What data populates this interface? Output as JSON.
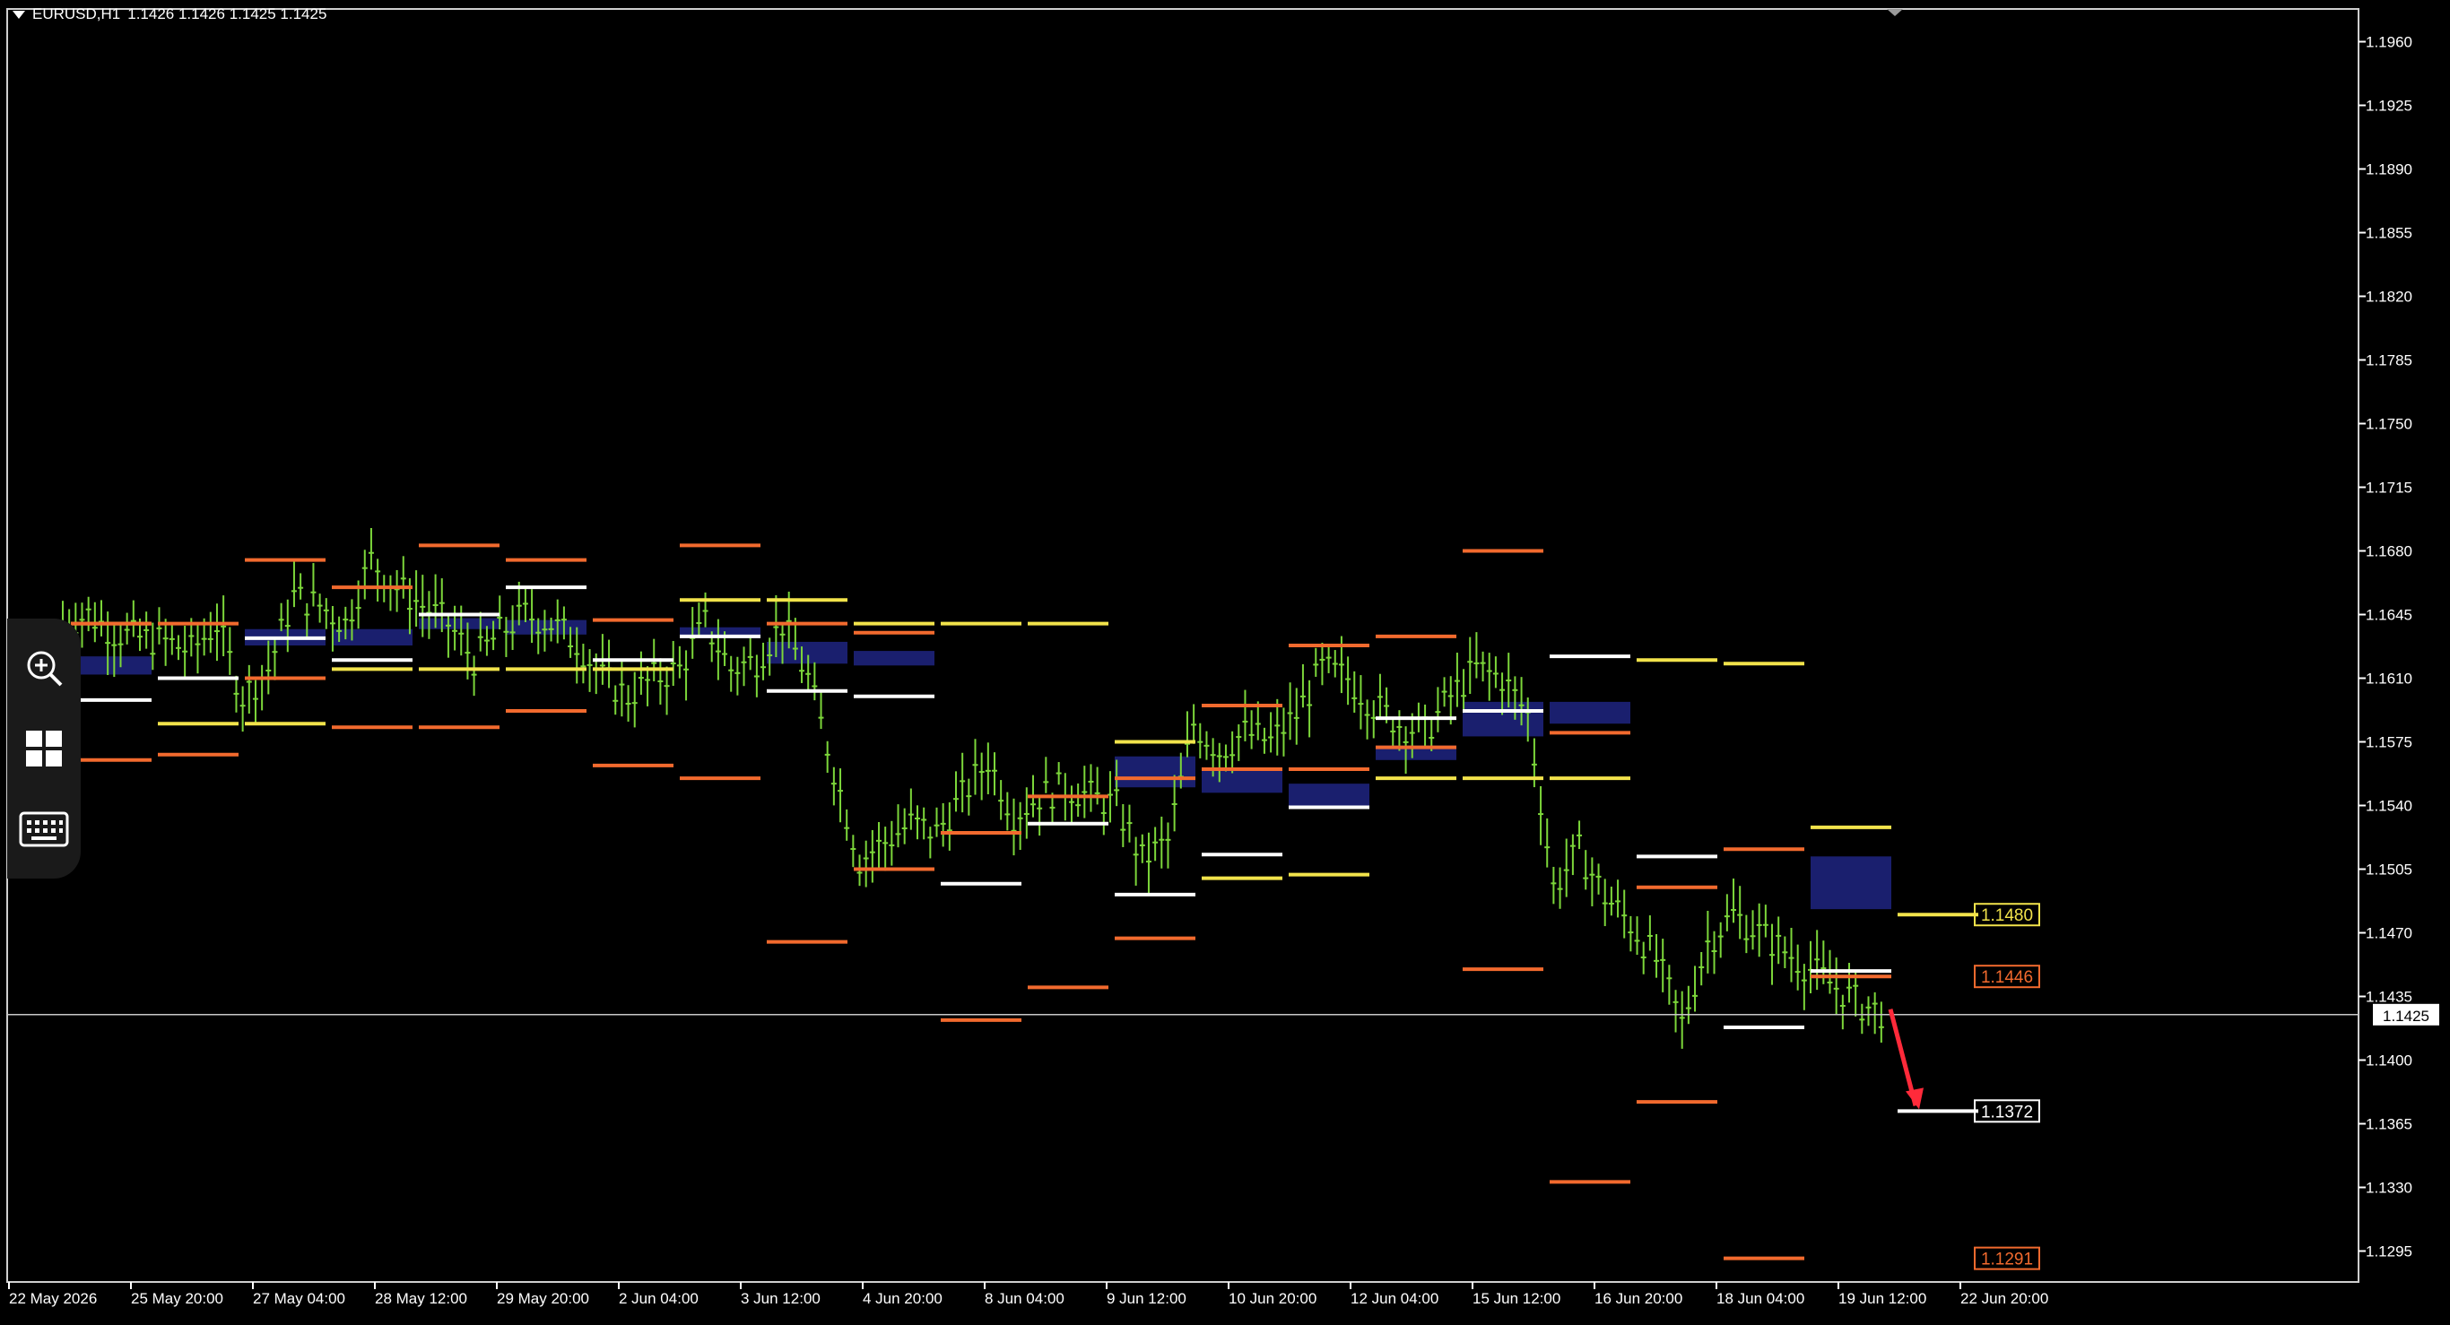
{
  "window": {
    "symbol_label": "EURUSD,H1",
    "ohlc_label": "1.1426 1.1426 1.1425 1.1425",
    "menu_icon": "triangle-down-icon"
  },
  "colors": {
    "background": "#000000",
    "candles": "#7cd63a",
    "axis": "#ffffff",
    "yellow_level": "#f2e34b",
    "orange_level": "#f26a2e",
    "white_level": "#ffffff",
    "zone_fill": "#1a1f6e",
    "arrow": "#ff2a3a",
    "bid_line": "#c8c8c8"
  },
  "price_axis": {
    "min": 1.1278,
    "max": 1.1978,
    "ticks": [
      "1.1960",
      "1.1925",
      "1.1890",
      "1.1855",
      "1.1820",
      "1.1785",
      "1.1750",
      "1.1715",
      "1.1680",
      "1.1645",
      "1.1610",
      "1.1575",
      "1.1540",
      "1.1505",
      "1.1470",
      "1.1435",
      "1.1400",
      "1.1365",
      "1.1330",
      "1.1295"
    ],
    "current_price_label": "1.1425",
    "current_price": 1.1425
  },
  "time_axis": {
    "labels": [
      "22 May 2026",
      "25 May 20:00",
      "27 May 04:00",
      "28 May 12:00",
      "29 May 20:00",
      "2 Jun 04:00",
      "3 Jun 12:00",
      "4 Jun 20:00",
      "8 Jun 04:00",
      "9 Jun 12:00",
      "10 Jun 20:00",
      "12 Jun 04:00",
      "15 Jun 12:00",
      "16 Jun 20:00",
      "18 Jun 04:00",
      "19 Jun 12:00",
      "22 Jun 20:00"
    ]
  },
  "price_labels": [
    {
      "text": "1.1480",
      "price": 1.148,
      "color": "#f2e34b"
    },
    {
      "text": "1.1446",
      "price": 1.1446,
      "color": "#f26a2e"
    },
    {
      "text": "1.1372",
      "price": 1.1372,
      "color": "#ffffff"
    },
    {
      "text": "1.1291",
      "price": 1.1291,
      "color": "#f26a2e"
    }
  ],
  "chart_data": {
    "type": "line",
    "description_units": "EURUSD H1 approximate close path",
    "x_labels": [
      "22 May 2026",
      "25 May 20:00",
      "27 May 04:00",
      "28 May 12:00",
      "29 May 20:00",
      "2 Jun 04:00",
      "3 Jun 12:00",
      "4 Jun 20:00",
      "8 Jun 04:00",
      "9 Jun 12:00",
      "10 Jun 20:00",
      "12 Jun 04:00",
      "15 Jun 12:00",
      "16 Jun 20:00",
      "18 Jun 04:00",
      "19 Jun 12:00",
      "22 Jun 20:00"
    ],
    "price_path": [
      1.164,
      1.1645,
      1.1635,
      1.1632,
      1.163,
      1.1625,
      1.164,
      1.16,
      1.1615,
      1.1655,
      1.165,
      1.164,
      1.1675,
      1.166,
      1.165,
      1.164,
      1.162,
      1.1635,
      1.1645,
      1.164,
      1.163,
      1.161,
      1.16,
      1.161,
      1.1615,
      1.164,
      1.1615,
      1.162,
      1.164,
      1.161,
      1.156,
      1.151,
      1.152,
      1.153,
      1.1525,
      1.1545,
      1.1565,
      1.1535,
      1.1545,
      1.155,
      1.1545,
      1.154,
      1.151,
      1.152,
      1.1585,
      1.157,
      1.158,
      1.1575,
      1.159,
      1.1615,
      1.161,
      1.1595,
      1.1585,
      1.158,
      1.16,
      1.1615,
      1.161,
      1.159,
      1.1495,
      1.1515,
      1.149,
      1.1475,
      1.1455,
      1.142,
      1.1465,
      1.148,
      1.147,
      1.146,
      1.145,
      1.144,
      1.143,
      1.1425
    ],
    "level_segments": {
      "yellow": [
        [
          1,
          1.164
        ],
        [
          2,
          1.1585
        ],
        [
          3,
          1.1585
        ],
        [
          4,
          1.1615
        ],
        [
          5,
          1.1615
        ],
        [
          6,
          1.1615
        ],
        [
          7,
          1.1615
        ],
        [
          8,
          1.1653
        ],
        [
          9,
          1.1653
        ],
        [
          10,
          1.164
        ],
        [
          11,
          1.164
        ],
        [
          12,
          1.164
        ],
        [
          13,
          1.1575
        ],
        [
          14,
          1.15
        ],
        [
          15,
          1.1502
        ],
        [
          16,
          1.1555
        ],
        [
          17,
          1.1555
        ],
        [
          18,
          1.1555
        ],
        [
          19,
          1.162
        ],
        [
          20,
          1.1618
        ],
        [
          21,
          1.1528
        ],
        [
          22,
          1.148
        ]
      ],
      "orange_top": [
        [
          1,
          1.164
        ],
        [
          2,
          1.164
        ],
        [
          3,
          1.1675
        ],
        [
          4,
          1.166
        ],
        [
          5,
          1.1683
        ],
        [
          6,
          1.1675
        ],
        [
          7,
          1.1642
        ],
        [
          8,
          1.1683
        ],
        [
          9,
          1.164
        ],
        [
          10,
          1.1635
        ],
        [
          11,
          1.1525
        ],
        [
          12,
          1.1545
        ],
        [
          13,
          1.1555
        ],
        [
          14,
          1.1595
        ],
        [
          15,
          1.1628
        ],
        [
          16,
          1.1633
        ],
        [
          17,
          1.168
        ],
        [
          18,
          1.158
        ],
        [
          19,
          1.1495
        ],
        [
          20,
          1.1516
        ],
        [
          21,
          1.1446
        ]
      ],
      "orange_bottom": [
        [
          1,
          1.1565
        ],
        [
          2,
          1.1568
        ],
        [
          3,
          1.161
        ],
        [
          4,
          1.1583
        ],
        [
          5,
          1.1583
        ],
        [
          6,
          1.1592
        ],
        [
          7,
          1.1562
        ],
        [
          8,
          1.1555
        ],
        [
          9,
          1.1465
        ],
        [
          10,
          1.1505
        ],
        [
          11,
          1.1422
        ],
        [
          12,
          1.144
        ],
        [
          13,
          1.1467
        ],
        [
          14,
          1.156
        ],
        [
          15,
          1.156
        ],
        [
          16,
          1.1572
        ],
        [
          17,
          1.145
        ],
        [
          18,
          1.1333
        ],
        [
          19,
          1.1377
        ],
        [
          20,
          1.1291
        ]
      ],
      "white": [
        [
          1,
          1.1598
        ],
        [
          2,
          1.161
        ],
        [
          3,
          1.1632
        ],
        [
          4,
          1.162
        ],
        [
          5,
          1.1645
        ],
        [
          6,
          1.166
        ],
        [
          7,
          1.162
        ],
        [
          8,
          1.1633
        ],
        [
          9,
          1.1603
        ],
        [
          10,
          1.16
        ],
        [
          11,
          1.1497
        ],
        [
          12,
          1.153
        ],
        [
          13,
          1.1491
        ],
        [
          14,
          1.1513
        ],
        [
          15,
          1.1539
        ],
        [
          16,
          1.1588
        ],
        [
          17,
          1.1592
        ],
        [
          18,
          1.1622
        ],
        [
          19,
          1.1512
        ],
        [
          20,
          1.1418
        ],
        [
          21,
          1.1449
        ],
        [
          22,
          1.1372
        ]
      ]
    },
    "zones": [
      [
        1,
        1.1622,
        1.1612
      ],
      [
        3,
        1.1637,
        1.1628
      ],
      [
        4,
        1.1637,
        1.1628
      ],
      [
        5,
        1.1643,
        1.1637
      ],
      [
        6,
        1.1642,
        1.1634
      ],
      [
        8,
        1.1638,
        1.1632
      ],
      [
        9,
        1.163,
        1.1618
      ],
      [
        10,
        1.1625,
        1.1617
      ],
      [
        13,
        1.1567,
        1.155
      ],
      [
        14,
        1.156,
        1.1547
      ],
      [
        15,
        1.1552,
        1.154
      ],
      [
        16,
        1.1573,
        1.1565
      ],
      [
        17,
        1.1597,
        1.1578
      ],
      [
        18,
        1.1597,
        1.1585
      ],
      [
        21,
        1.1512,
        1.1483
      ]
    ],
    "arrow": {
      "from_price": 1.1428,
      "to_price": 1.1372
    }
  }
}
